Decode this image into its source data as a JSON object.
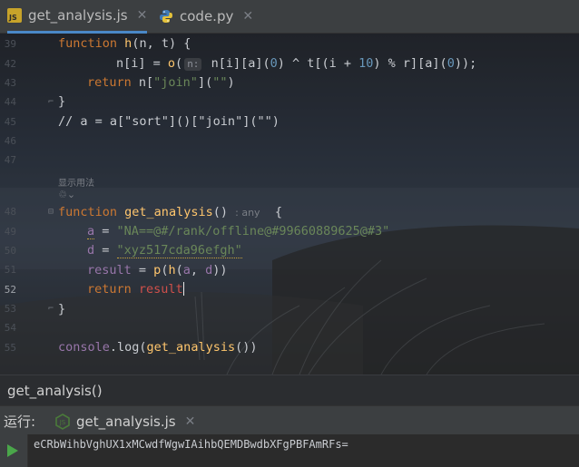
{
  "tabs": [
    {
      "label": "get_analysis.js",
      "icon": "js-file-icon",
      "close": "✕",
      "active": true
    },
    {
      "label": "code.py",
      "icon": "python-file-icon",
      "close": "✕",
      "active": false
    }
  ],
  "editor": {
    "line_numbers": [
      "39",
      "42",
      "43",
      "44",
      "45",
      "46",
      "47",
      "",
      "48",
      "49",
      "50",
      "51",
      "52",
      "53",
      "54",
      "55"
    ],
    "hint_label": "显示用法",
    "lines": {
      "l39": {
        "kw": "function",
        "fn": "h",
        "rest": "(n, t) {"
      },
      "l42": {
        "a": "n[i] = ",
        "fn": "o",
        "b": "(",
        "hint": "n:",
        "c": " n[i][a](",
        "n0": "0",
        "d": ") ^ t[(i + ",
        "n10": "10",
        "e": ") % r][a](",
        "n0b": "0",
        "f": "));"
      },
      "l43": {
        "kw": "return",
        "a": " n[",
        "str": "\"join\"",
        "b": "](",
        "str2": "\"\"",
        "c": ")"
      },
      "l44": {
        "text": "}"
      },
      "l45": {
        "text": "// a = a[\"sort\"]()[\"join\"](\"\")"
      },
      "l48": {
        "kw": "function",
        "fn": "get_analysis",
        "a": "()",
        "inlay": ": any",
        "b": "  {"
      },
      "l49": {
        "var": "a",
        "eq": " = ",
        "str": "\"NA==@#/rank/offline@#99660889625@#3\""
      },
      "l50": {
        "var": "d",
        "eq": " = ",
        "str": "\"xyz517cda96efgh\""
      },
      "l51": {
        "var": "result",
        "eq": " = ",
        "fn": "p",
        "a": "(",
        "fn2": "h",
        "b": "(",
        "v1": "a",
        "c": ", ",
        "v2": "d",
        "d": "))"
      },
      "l52": {
        "kw": "return",
        "var": " result"
      },
      "l53": {
        "text": "}"
      },
      "l55": {
        "var": "console",
        "a": ".log(",
        "fn": "get_analysis",
        "b": "())"
      }
    }
  },
  "breadcrumb": {
    "text": "get_analysis()"
  },
  "run": {
    "label": "运行:",
    "tab_label": "get_analysis.js",
    "close": "✕",
    "output": "eCRbWihbVghUX1xMCwdfWgwIAihbQEMDBwdbXFgPBFAmRFs="
  },
  "colors": {
    "keyword": "#cc7832",
    "function": "#ffc66d",
    "string": "#6a8759",
    "number": "#6897bb",
    "variable": "#9876aa",
    "accent": "#4a88c7",
    "run_green": "#4aa64a"
  }
}
